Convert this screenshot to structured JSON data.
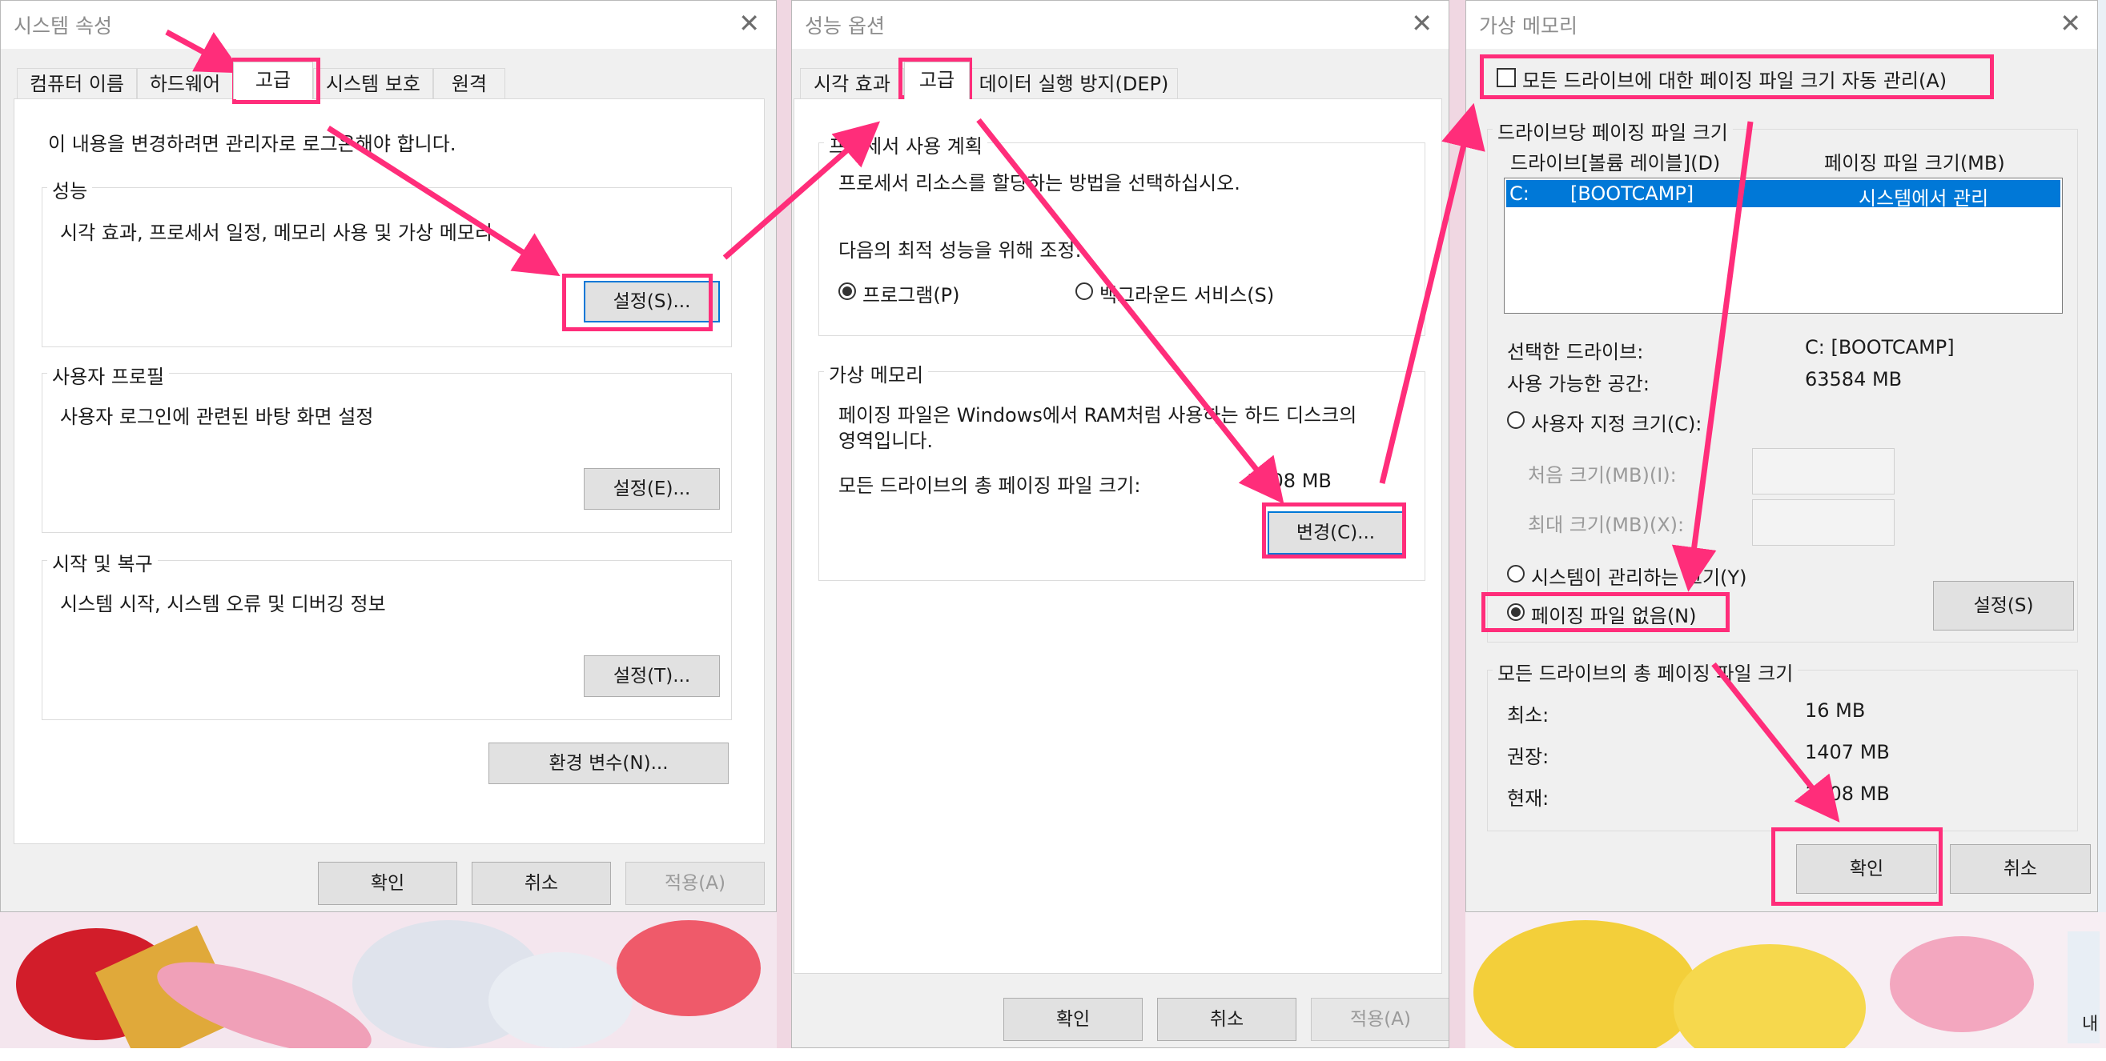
{
  "window1": {
    "title": "시스템 속성",
    "close": "✕",
    "tabs": [
      "컴퓨터 이름",
      "하드웨어",
      "고급",
      "시스템 보호",
      "원격"
    ],
    "admin_notice": "이 내용을 변경하려면 관리자로 로그온해야 합니다.",
    "performance": {
      "title": "성능",
      "desc": "시각 효과, 프로세서 일정, 메모리 사용 및 가상 메모리",
      "button": "설정(S)..."
    },
    "profile": {
      "title": "사용자 프로필",
      "desc": "사용자 로그인에 관련된 바탕 화면 설정",
      "button": "설정(E)..."
    },
    "startup": {
      "title": "시작 및 복구",
      "desc": "시스템 시작, 시스템 오류 및 디버깅 정보",
      "button": "설정(T)..."
    },
    "env_button": "환경 변수(N)...",
    "ok": "확인",
    "cancel": "취소",
    "apply": "적용(A)"
  },
  "window2": {
    "title": "성능 옵션",
    "close": "✕",
    "tabs": [
      "시각 효과",
      "고급",
      "데이터 실행 방지(DEP)"
    ],
    "processor": {
      "title": "프로세서 사용 계획",
      "desc": "프로세서 리소스를 할당하는 방법을 선택하십시오.",
      "optimize": "다음의 최적 성능을 위해 조정:",
      "opt1": "프로그램(P)",
      "opt2": "백그라운드 서비스(S)"
    },
    "virtual": {
      "title": "가상 메모리",
      "desc1": "페이징 파일은 Windows에서 RAM처럼 사용하는 하드 디스크의",
      "desc2": "영역입니다.",
      "total_label": "모든 드라이브의 총 페이징 파일 크기:",
      "total_value": "1408 MB",
      "button": "변경(C)..."
    },
    "ok": "확인",
    "cancel": "취소",
    "apply": "적용(A)"
  },
  "window3": {
    "title": "가상 메모리",
    "close": "✕",
    "auto_manage": "모든 드라이브에 대한 페이징 파일 크기 자동 관리(A)",
    "per_drive_title": "드라이브당 페이징 파일 크기",
    "col_drive": "드라이브[볼륨 레이블](D)",
    "col_size": "페이징 파일 크기(MB)",
    "drive_row": {
      "drive": "C:",
      "label": "[BOOTCAMP]",
      "size": "시스템에서 관리"
    },
    "selected_drive_label": "선택한 드라이브:",
    "selected_drive_value": "C:  [BOOTCAMP]",
    "free_space_label": "사용 가능한 공간:",
    "free_space_value": "63584 MB",
    "custom_size": "사용자 지정 크기(C):",
    "initial_size": "처음 크기(MB)(I):",
    "max_size": "최대 크기(MB)(X):",
    "system_managed": "시스템이 관리하는 크기(Y)",
    "no_paging": "페이징 파일 없음(N)",
    "set_button": "설정(S)",
    "totals_title": "모든 드라이브의 총 페이징 파일 크기",
    "min_label": "최소:",
    "min_value": "16 MB",
    "rec_label": "권장:",
    "rec_value": "1407 MB",
    "cur_label": "현재:",
    "cur_value": "1408 MB",
    "ok": "확인",
    "cancel": "취소"
  },
  "desktop": {
    "corner_text": "내"
  },
  "colors": {
    "highlight": "#ff2d7a",
    "selection": "#0078d7",
    "window_bg": "#f0f0f0"
  }
}
